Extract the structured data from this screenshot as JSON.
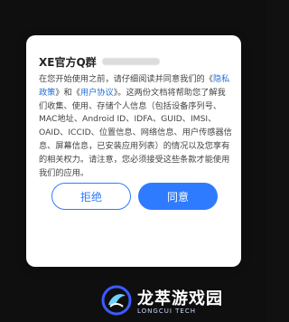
{
  "dialog": {
    "title": "XE官方Q群",
    "body_lines": [
      "在您开始使用之前，请仔细阅读并同意我们的《",
      "隐私政策",
      "》和《",
      "用户协议",
      "》。这两份文档将帮助您了解我们收集、使用、存储个人信息（包括设备序列号、MAC地址、Android ID、IDFA、GUID、IMSI、OAID、ICCID、位置信息、网络信息、用户传感器信息、屏幕信息，已安装应用列表）的情况以及您享有的相关权力。请注意，您必须接受这些条款才能使用我们的应用。"
    ],
    "reject_label": "拒绝",
    "agree_label": "同意"
  },
  "watermark": {
    "brand_cn": "龙萃游戏园",
    "brand_en": "LONGCUI TECH"
  },
  "colors": {
    "accent": "#2f7bff",
    "background": "#0f0f0f"
  }
}
